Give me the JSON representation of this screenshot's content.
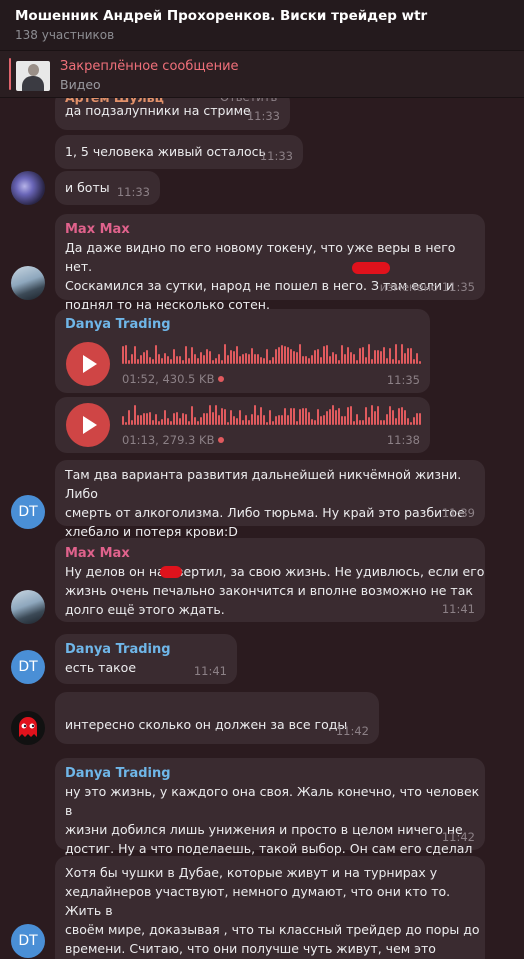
{
  "header": {
    "title": "Мошенник Андрей Прохоренков. Виски трейдер wtr",
    "subtitle": "138 участников"
  },
  "pinned": {
    "label": "Закреплённое сообщение",
    "preview": "Видео"
  },
  "colors": {
    "background": "#2b1b1f",
    "bubble": "#3a2b30",
    "accent": "#e0646c",
    "max_max_name": "#e0628c",
    "danya_name": "#6fb6e8",
    "voice_play": "#cf4545"
  },
  "messages": [
    {
      "reply_fragment": "Артём Шульц",
      "reply_action": "Ответить",
      "text": "да подзалупники на стриме",
      "time": "11:33"
    },
    {
      "text": "1, 5 человека живый осталось",
      "time": "11:33"
    },
    {
      "text": "и боты",
      "time": "11:33"
    },
    {
      "sender": "Max Max",
      "text": "Да даже видно по его новому токену, что уже веры в него нет.\nСоскамился за сутки, народ не пошел в него. З          там если и\nподнял то на несколько сотен.",
      "time": "изменено 11:35"
    },
    {
      "sender": "Danya Trading",
      "voice": {
        "duration": "01:52, 430.5 KB",
        "time": "11:35"
      }
    },
    {
      "voice": {
        "duration": "01:13, 279.3 KB",
        "time": "11:38"
      }
    },
    {
      "avatar": "DT",
      "text": "Там два варианта развития дальнейшей никчёмной жизни. Либо\nсмерть от алкоголизма. Либо тюрьма. Ну край это разбитое\nхлебало и потеря крови:D",
      "time": "11:39"
    },
    {
      "sender": "Max Max",
      "text": "Ну делов он нах      вертил, за свою жизнь. Не удивлюсь, если его\nжизнь очень печально закончится и вполне возможно не так\nдолго ещё этого ждать.",
      "time": "11:41"
    },
    {
      "sender": "Danya Trading",
      "avatar": "DT",
      "text": "есть такое",
      "time": "11:41"
    },
    {
      "text": "интересно сколько он должен за все годы",
      "time": "11:42"
    },
    {
      "sender": "Danya Trading",
      "text": "ну это жизнь,  у каждого она своя. Жаль конечно, что человек в\nжизни добился лишь унижения и просто в целом ничего не\nдостиг. Ну а что поделаешь, такой выбор. Он сам его сделал",
      "time": "11:42"
    },
    {
      "avatar": "DT",
      "text": "Хотя бы чушки в Дубае, которые живут и на турнирах у\nхедлайнеров участвуют, немного думают, что они кто то. Жить в\nсвоём мире, доказывая , что ты классный трейдер до поры до\nвремени. Считаю, что они получше чуть живут, чем это чучело.\nХотя по факту разница небольшая, что те, что те обсыкают"
    }
  ]
}
